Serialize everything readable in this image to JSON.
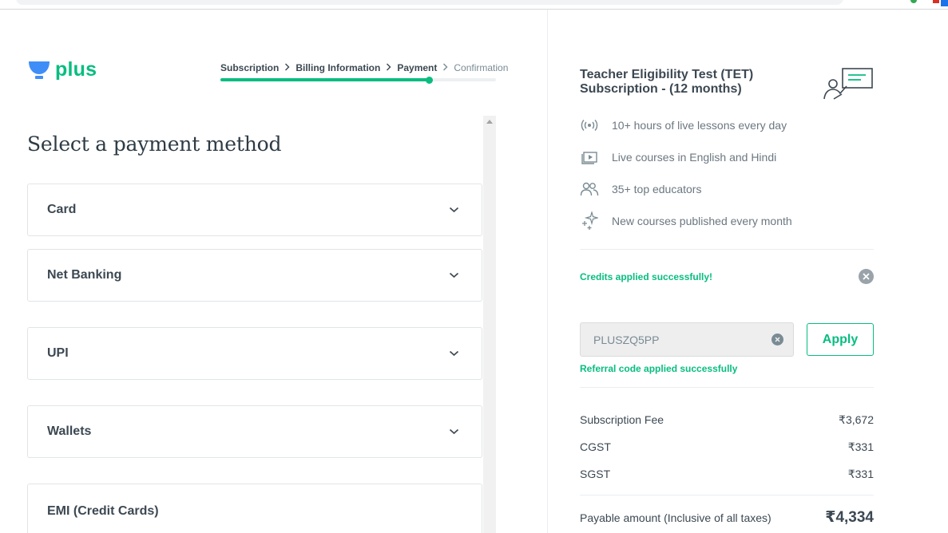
{
  "brand": {
    "name": "plus",
    "accent": "#08bd80",
    "logo_blue": "#3f8ef7"
  },
  "stepper": {
    "steps": [
      "Subscription",
      "Billing Information",
      "Payment",
      "Confirmation"
    ],
    "progress": 0.76
  },
  "main": {
    "heading": "Select a payment method",
    "methods": [
      {
        "label": "Card"
      },
      {
        "label": "Net Banking"
      },
      {
        "label": "UPI"
      },
      {
        "label": "Wallets"
      },
      {
        "label": "EMI (Credit Cards)"
      }
    ]
  },
  "summary": {
    "title": "Teacher Eligibility Test (TET) Subscription - (12 months)",
    "features": [
      {
        "icon": "live-broadcast-icon",
        "text": "10+ hours of live lessons every day"
      },
      {
        "icon": "video-play-icon",
        "text": "Live courses in English and Hindi"
      },
      {
        "icon": "educators-icon",
        "text": "35+ top educators"
      },
      {
        "icon": "sparkle-icon",
        "text": "New courses published every month"
      }
    ],
    "credits_message": "Credits applied successfully!",
    "referral": {
      "code": "PLUSZQ5PP",
      "apply_label": "Apply",
      "success_message": "Referral code applied successfully"
    },
    "fees": [
      {
        "label": "Subscription Fee",
        "value": "₹3,672"
      },
      {
        "label": "CGST",
        "value": "₹331"
      },
      {
        "label": "SGST",
        "value": "₹331"
      }
    ],
    "payable": {
      "label": "Payable amount (Inclusive of all taxes)",
      "value": "₹4,334"
    }
  }
}
